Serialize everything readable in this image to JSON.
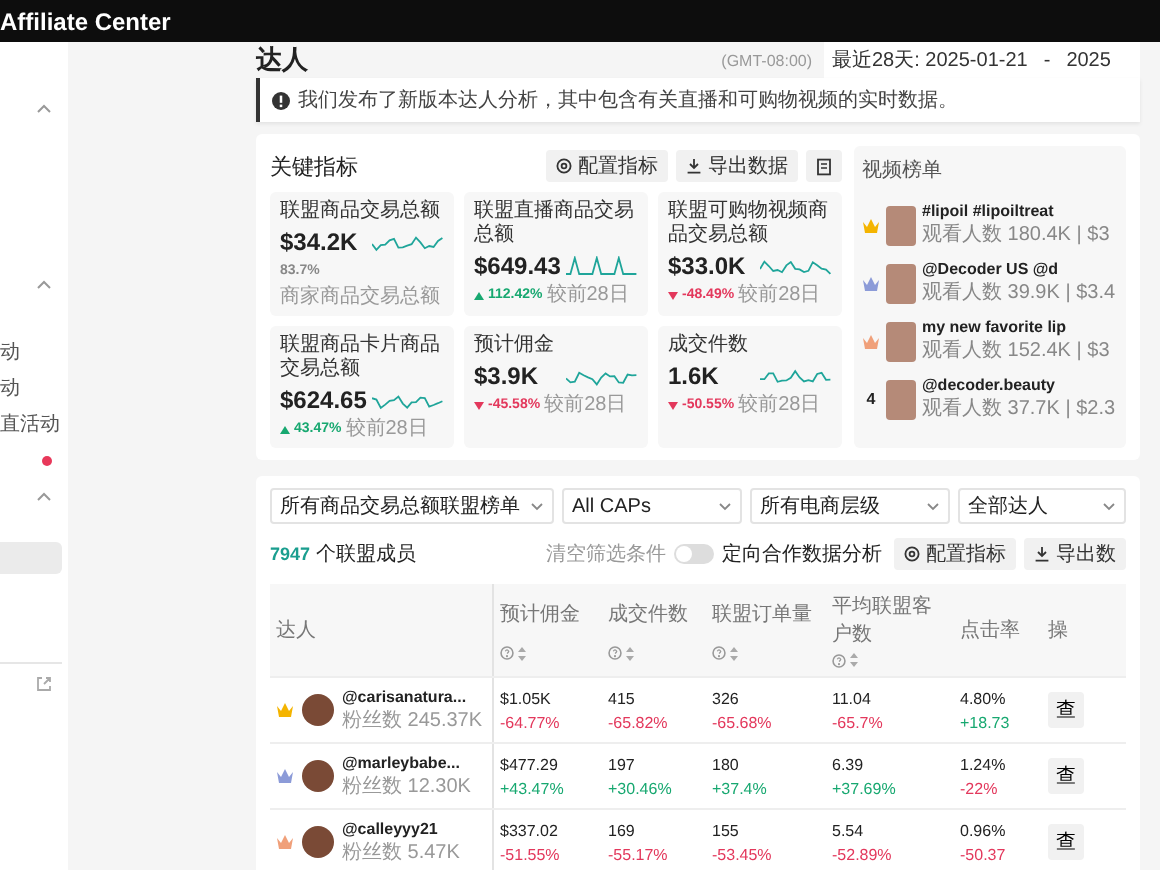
{
  "top_bar": {
    "title": "Affiliate Center"
  },
  "sidebar": {
    "items": [
      {
        "kind": "group",
        "expanded": true
      },
      {
        "kind": "group",
        "expanded": true
      },
      {
        "kind": "link",
        "label": "动"
      },
      {
        "kind": "link",
        "label": "动"
      },
      {
        "kind": "link",
        "label": "直活动"
      },
      {
        "kind": "dot"
      },
      {
        "kind": "group",
        "expanded": true
      },
      {
        "kind": "entry",
        "selected": true
      },
      {
        "kind": "external"
      }
    ]
  },
  "page": {
    "title": "达人",
    "timezone": "(GMT-08:00)",
    "date_start": "最近28天: 2025-01-21",
    "date_separator": "-",
    "date_end": "2025"
  },
  "notice": {
    "text": "我们发布了新版本达人分析，其中包含有关直播和可购物视频的实时数据。"
  },
  "key_metrics": {
    "title": "关键指标",
    "buttons": [
      {
        "kind": "config",
        "label": "配置指标"
      },
      {
        "kind": "export",
        "label": "导出数据"
      },
      {
        "kind": "icon"
      }
    ],
    "metrics": [
      {
        "label": "联盟商品交易总额",
        "value": "$34.2K",
        "kind": "plain",
        "change": "83.7%",
        "note": "商家商品交易总额"
      },
      {
        "label": "联盟直播商品交易总额",
        "value": "$649.43",
        "kind": "up",
        "change": "112.42%",
        "note": "较前28日"
      },
      {
        "label": "联盟可购物视频商品交易总额",
        "value": "$33.0K",
        "kind": "down",
        "change": "-48.49%",
        "note": "较前28日"
      },
      {
        "label": "联盟商品卡片商品交易总额",
        "value": "$624.65",
        "kind": "up",
        "change": "43.47%",
        "note": "较前28日"
      },
      {
        "label": "预计佣金",
        "value": "$3.9K",
        "kind": "down",
        "change": "-45.58%",
        "note": "较前28日"
      },
      {
        "label": "成交件数",
        "value": "1.6K",
        "kind": "down",
        "change": "-50.55%",
        "note": "较前28日"
      }
    ]
  },
  "video_ranking": {
    "title": "视频榜单",
    "videos": [
      {
        "kind": "gold",
        "title": "#lipoil #lipoiltreat",
        "stats": "观看人数 180.4K | $3"
      },
      {
        "kind": "silver",
        "title": "@Decoder US @d",
        "stats": "观看人数 39.9K | $3.4"
      },
      {
        "kind": "bronze",
        "title": "my new favorite lip",
        "stats": "观看人数 152.4K | $3"
      },
      {
        "kind": "number",
        "rank": "4",
        "title": "@decoder.beauty",
        "stats": "观看人数 37.7K | $2.3"
      }
    ]
  },
  "members": {
    "filters": [
      {
        "value": "所有商品交易总额联盟榜单"
      },
      {
        "value": "All CAPs"
      },
      {
        "value": "所有电商层级"
      },
      {
        "value": "全部达人"
      }
    ],
    "count": "7947",
    "count_label": "个联盟成员",
    "clear_label": "清空筛选条件",
    "toggle": {
      "label": "定向合作数据分析",
      "on": false
    },
    "buttons": [
      {
        "kind": "config",
        "label": "配置指标"
      },
      {
        "kind": "export",
        "label": "导出数"
      }
    ],
    "table": {
      "columns": [
        {
          "label": "达人",
          "kind": "plain"
        },
        {
          "label": "预计佣金",
          "kind": "sortable"
        },
        {
          "label": "成交件数",
          "kind": "sortable"
        },
        {
          "label": "联盟订单量",
          "kind": "sortable"
        },
        {
          "label": "平均联盟客户数",
          "kind": "sortable"
        },
        {
          "label": "点击率",
          "kind": "plain"
        },
        {
          "label": "操",
          "kind": "plain"
        }
      ],
      "rows": [
        {
          "cells": [
            {
              "kind": "gold",
              "handle": "@carisanatura...",
              "followers": "粉丝数 245.37K"
            },
            {
              "kind": "down",
              "value": "$1.05K",
              "change": "-64.77%"
            },
            {
              "kind": "down",
              "value": "415",
              "change": "-65.82%"
            },
            {
              "kind": "down",
              "value": "326",
              "change": "-65.68%"
            },
            {
              "kind": "down",
              "value": "11.04",
              "change": "-65.7%"
            },
            {
              "kind": "up",
              "value": "4.80%",
              "change": "+18.73"
            },
            {
              "kind": "action",
              "label": "查"
            }
          ]
        },
        {
          "cells": [
            {
              "kind": "silver",
              "handle": "@marleybabe...",
              "followers": "粉丝数 12.30K"
            },
            {
              "kind": "up",
              "value": "$477.29",
              "change": "+43.47%"
            },
            {
              "kind": "up",
              "value": "197",
              "change": "+30.46%"
            },
            {
              "kind": "up",
              "value": "180",
              "change": "+37.4%"
            },
            {
              "kind": "up",
              "value": "6.39",
              "change": "+37.69%"
            },
            {
              "kind": "down",
              "value": "1.24%",
              "change": "-22%"
            },
            {
              "kind": "action",
              "label": "查"
            }
          ]
        },
        {
          "cells": [
            {
              "kind": "bronze",
              "handle": "@calleyyy21",
              "followers": "粉丝数 5.47K"
            },
            {
              "kind": "down",
              "value": "$337.02",
              "change": "-51.55%"
            },
            {
              "kind": "down",
              "value": "169",
              "change": "-55.17%"
            },
            {
              "kind": "down",
              "value": "155",
              "change": "-53.45%"
            },
            {
              "kind": "down",
              "value": "5.54",
              "change": "-52.89%"
            },
            {
              "kind": "down",
              "value": "0.96%",
              "change": "-50.37"
            },
            {
              "kind": "action",
              "label": "查"
            }
          ]
        }
      ]
    }
  }
}
